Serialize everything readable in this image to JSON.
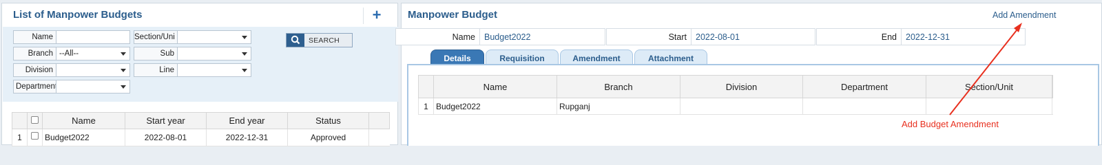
{
  "left_panel": {
    "title": "List of Manpower Budgets",
    "add_icon": "plus-icon",
    "filters": {
      "name_label": "Name",
      "name_value": "",
      "section_label": "Section/Uni",
      "section_value": "",
      "branch_label": "Branch",
      "branch_value": "--All--",
      "sub_label": "Sub",
      "sub_value": "",
      "division_label": "Division",
      "division_value": "",
      "line_label": "Line",
      "line_value": "",
      "department_label": "Department",
      "department_value": "",
      "search_label": "SEARCH",
      "search_icon": "search-icon"
    },
    "grid": {
      "columns": [
        "Name",
        "Start year",
        "End year",
        "Status"
      ],
      "rows": [
        {
          "num": "1",
          "name": "Budget2022",
          "start": "2022-08-01",
          "end": "2022-12-31",
          "status": "Approved"
        }
      ]
    }
  },
  "right_panel": {
    "title": "Manpower Budget",
    "add_amendment": "Add Amendment",
    "header": {
      "name_label": "Name",
      "name_value": "Budget2022",
      "start_label": "Start",
      "start_value": "2022-08-01",
      "end_label": "End",
      "end_value": "2022-12-31"
    },
    "tabs": [
      "Details",
      "Requisition",
      "Amendment",
      "Attachment"
    ],
    "active_tab": "Details",
    "details_grid": {
      "columns": [
        "Name",
        "Branch",
        "Division",
        "Department",
        "Section/Unit"
      ],
      "rows": [
        {
          "num": "1",
          "name": "Budget2022",
          "branch": "Rupganj",
          "division": "",
          "department": "",
          "section": ""
        }
      ]
    }
  },
  "annotation": {
    "text": "Add Budget Amendment",
    "color": "#e8301f"
  },
  "colors": {
    "title": "#2b5d8c",
    "active_tab": "#3a78b5",
    "filter_bg": "#e6f0f8"
  }
}
